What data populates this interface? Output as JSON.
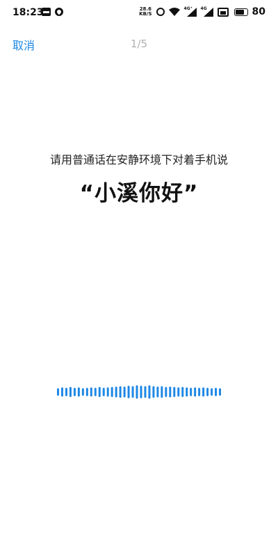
{
  "status_bar": {
    "time": "18:23",
    "net_speed_value": "28.6",
    "net_speed_unit": "KB/S",
    "signal_1_tag": "4G⁺",
    "signal_2_tag": "4G",
    "battery_level": "80",
    "battery_fraction": 0.8,
    "icons": [
      "sim-icon",
      "drop-icon",
      "alarm-icon",
      "wifi-icon",
      "signal-icon",
      "signal-icon",
      "hd-icon",
      "battery-icon"
    ]
  },
  "header": {
    "cancel_label": "取消",
    "step": "1/5"
  },
  "main": {
    "instruction": "请用普通话在安静环境下对着手机说",
    "wake_phrase": "“小溪你好”"
  },
  "waveform": {
    "bar_count": 40,
    "color": "#1e88e5",
    "levels": [
      0.45,
      0.55,
      0.5,
      0.6,
      0.5,
      0.55,
      0.45,
      0.5,
      0.55,
      0.5,
      0.6,
      0.5,
      0.55,
      0.6,
      0.65,
      0.7,
      0.65,
      0.75,
      0.7,
      0.8,
      0.75,
      0.7,
      0.8,
      0.7,
      0.65,
      0.7,
      0.6,
      0.65,
      0.6,
      0.55,
      0.6,
      0.55,
      0.5,
      0.55,
      0.5,
      0.55,
      0.5,
      0.45,
      0.5,
      0.45
    ]
  },
  "colors": {
    "accent": "#1e88e5",
    "step_gray": "#b0b0b0",
    "text": "#111111"
  }
}
